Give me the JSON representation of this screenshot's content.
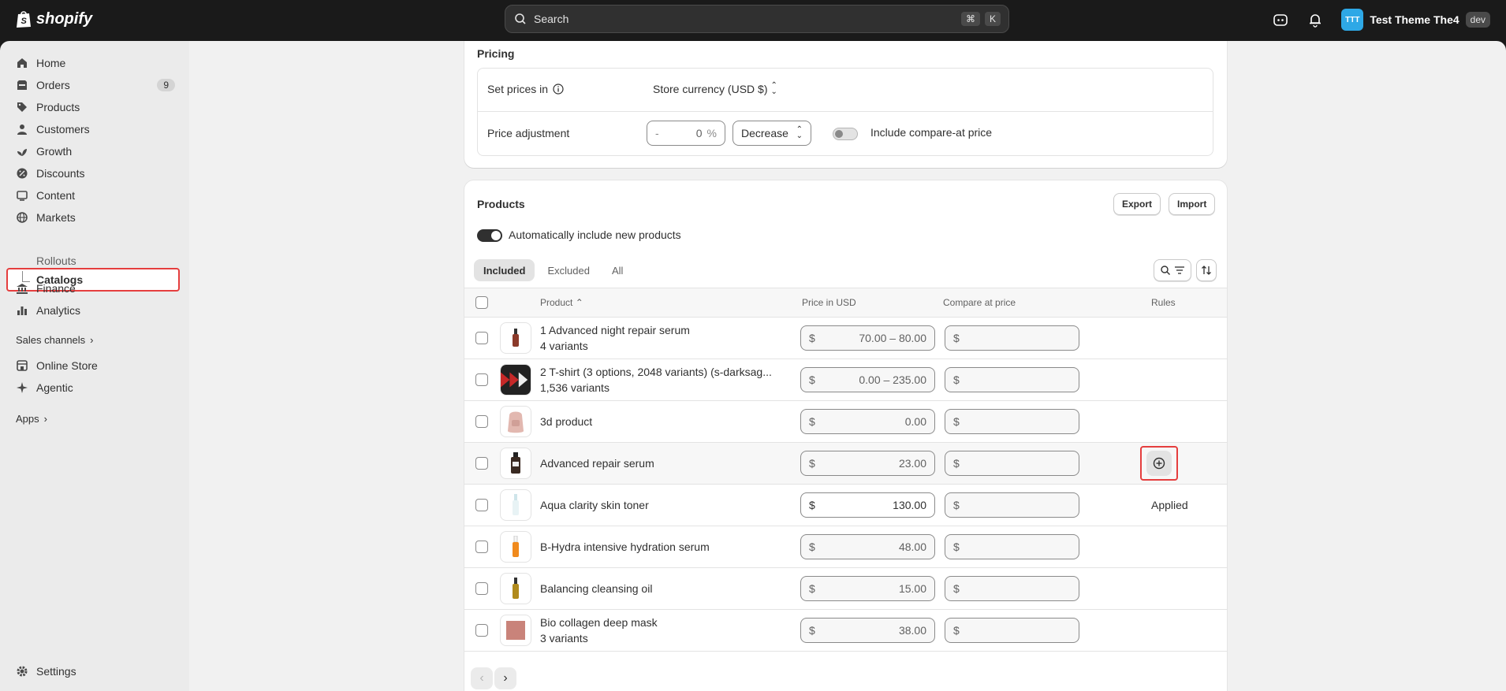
{
  "topbar": {
    "brand": "shopify",
    "search_placeholder": "Search",
    "shortcut_keys": [
      "⌘",
      "K"
    ],
    "store_initials": "TTT",
    "store_name": "Test Theme The4",
    "env_badge": "dev"
  },
  "sidebar": {
    "items": [
      {
        "label": "Home",
        "icon": "home-icon"
      },
      {
        "label": "Orders",
        "icon": "orders-icon",
        "badge": "9"
      },
      {
        "label": "Products",
        "icon": "tag-icon"
      },
      {
        "label": "Customers",
        "icon": "person-icon"
      },
      {
        "label": "Growth",
        "icon": "growth-icon"
      },
      {
        "label": "Discounts",
        "icon": "discount-icon"
      },
      {
        "label": "Content",
        "icon": "content-icon"
      },
      {
        "label": "Markets",
        "icon": "globe-icon"
      }
    ],
    "markets_sub": [
      "Catalogs",
      "Rollouts"
    ],
    "items2": [
      {
        "label": "Finance",
        "icon": "bank-icon"
      },
      {
        "label": "Analytics",
        "icon": "chart-icon"
      }
    ],
    "sales_channels_label": "Sales channels",
    "channels": [
      {
        "label": "Online Store",
        "icon": "store-icon"
      },
      {
        "label": "Agentic",
        "icon": "agentic-icon"
      }
    ],
    "apps_label": "Apps",
    "settings_label": "Settings"
  },
  "pricing": {
    "title": "Pricing",
    "set_prices_label": "Set prices in",
    "currency_value": "Store currency (USD $)",
    "adjustment_label": "Price adjustment",
    "adjustment_prefix": "-",
    "adjustment_value": "0",
    "adjustment_suffix": "%",
    "direction_value": "Decrease",
    "compare_toggle_label": "Include compare-at price"
  },
  "products": {
    "title": "Products",
    "export_label": "Export",
    "import_label": "Import",
    "auto_include_label": "Automatically include new products",
    "tabs": [
      "Included",
      "Excluded",
      "All"
    ],
    "columns": {
      "product": "Product",
      "price": "Price in USD",
      "compare": "Compare at price",
      "rules": "Rules"
    },
    "currency_symbol": "$",
    "rows": [
      {
        "name": "1 Advanced night repair serum",
        "variants": "4 variants",
        "price": "70.00 – 80.00",
        "rule": ""
      },
      {
        "name": "2 T-shirt (3 options, 2048 variants) (s-darksag...",
        "variants": "1,536 variants",
        "price": "0.00 – 235.00",
        "rule": ""
      },
      {
        "name": "3d product",
        "variants": "",
        "price": "0.00",
        "rule": ""
      },
      {
        "name": "Advanced repair serum",
        "variants": "",
        "price": "23.00",
        "rule": "add"
      },
      {
        "name": "Aqua clarity skin toner",
        "variants": "",
        "price": "130.00",
        "rule": "Applied"
      },
      {
        "name": "B-Hydra intensive hydration serum",
        "variants": "",
        "price": "48.00",
        "rule": ""
      },
      {
        "name": "Balancing cleansing oil",
        "variants": "",
        "price": "15.00",
        "rule": ""
      },
      {
        "name": "Bio collagen deep mask",
        "variants": "3 variants",
        "price": "38.00",
        "rule": ""
      }
    ],
    "pager": {
      "prev": "‹",
      "next": "›"
    }
  },
  "colors": {
    "topbar": "#1a1a1a",
    "highlight": "#e53e3e",
    "avatar": "#2ea8e6"
  }
}
